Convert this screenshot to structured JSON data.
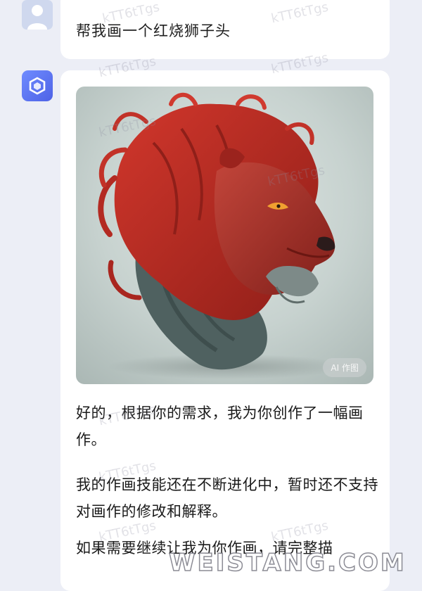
{
  "user_message": {
    "text": "帮我画一个红烧狮子头"
  },
  "bot_message": {
    "image_badge": "AI 作图",
    "paragraphs": [
      "好的，根据你的需求，我为你创作了一幅画作。",
      "我的作画技能还在不断进化中，暂时还不支持对画作的修改和解释。",
      "如果需要继续让我为你作画，请完整描"
    ]
  },
  "watermark": {
    "text": "kTT6tTgs"
  },
  "site_watermark": {
    "text": "WEISTANG.COM"
  },
  "icons": {
    "user_avatar": "user-avatar-icon",
    "bot_avatar": "bot-avatar-icon"
  },
  "colors": {
    "background": "#eceef6",
    "bubble": "#ffffff",
    "bot_accent": "#5b6ef5",
    "lion_red": "#b22a22"
  }
}
